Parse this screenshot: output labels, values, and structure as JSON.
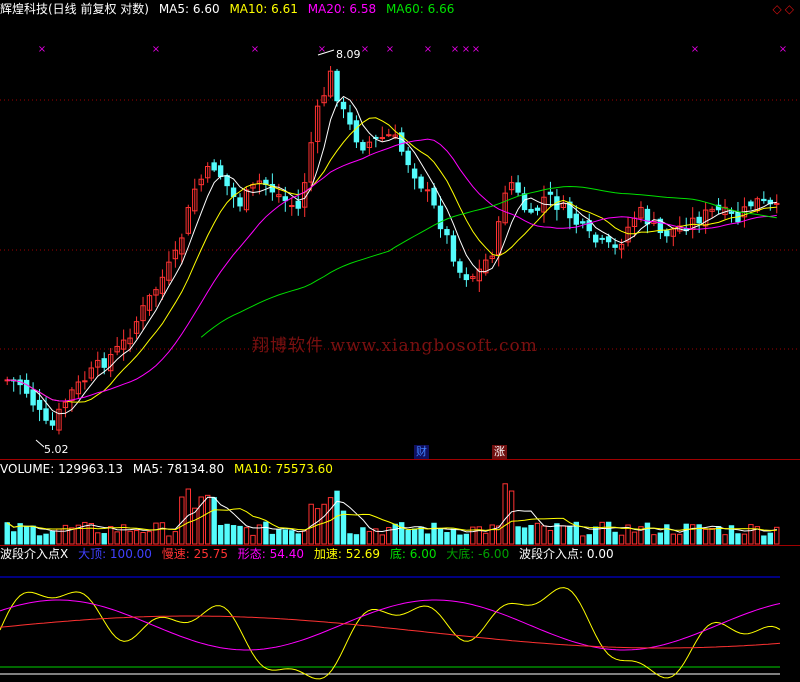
{
  "header": {
    "title": "辉煌科技(日线 前复权 对数)",
    "ma5": "MA5: 6.60",
    "ma10": "MA10: 6.61",
    "ma20": "MA20: 6.58",
    "ma60": "MA60: 6.66",
    "corner_icons": "◇◇"
  },
  "volume_header": {
    "volume": "VOLUME: 129963.13",
    "ma5": "MA5: 78134.80",
    "ma10": "MA10: 75573.60"
  },
  "indicator_header": {
    "name": "波段介入点X",
    "top_label": "大顶: 100.00",
    "slow_label": "慢速: 25.75",
    "shape_label": "形态: 54.40",
    "accel_label": "加速: 52.69",
    "bottom_label": "底: 6.00",
    "big_bottom_label": "大底: -6.00",
    "entry_label": "波段介入点: 0.00"
  },
  "annotations": {
    "high": "8.09",
    "low": "5.02",
    "event_cai": "财",
    "event_zhang": "涨"
  },
  "watermark": "翔博软件  www.xiangbosoft.com",
  "colors": {
    "up": "#ff3232",
    "down": "#54fcfc",
    "ma5": "#ffffff",
    "ma10": "#ffff00",
    "ma20": "#ff00ff",
    "ma60": "#00e000",
    "top_line": "#0000ff",
    "bottom_line": "#00d000",
    "grid": "#a00000",
    "marker": "#e000e0"
  },
  "chart_data": {
    "type": "candlestick",
    "price_range": [
      5.02,
      8.09
    ],
    "scale": "log",
    "high_value": 8.09,
    "low_value": 5.02,
    "event_markers": [
      "财",
      "涨"
    ]
  }
}
